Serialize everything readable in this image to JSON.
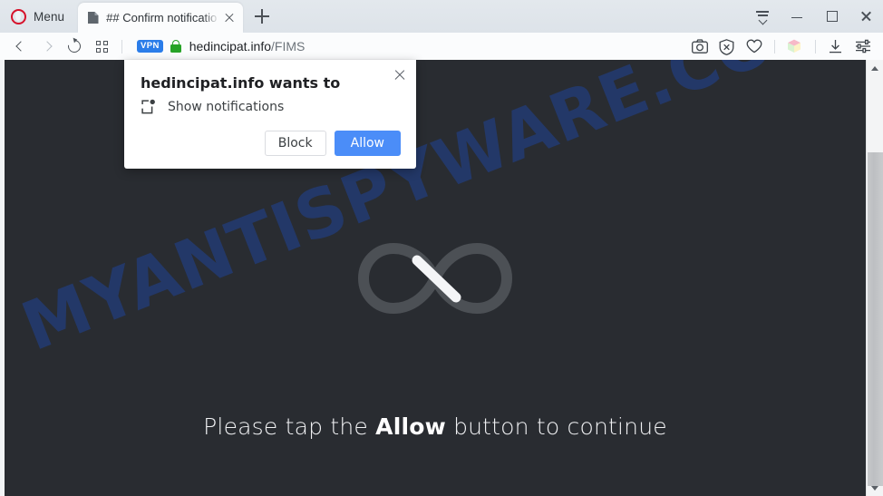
{
  "browser": {
    "name": "Opera",
    "menu_label": "Menu",
    "logo_icon": "opera-logo-icon",
    "tabs": [
      {
        "title": "## Confirm notificatio",
        "favicon": "page-document-icon",
        "close_icon": "close-icon",
        "active": true
      }
    ],
    "new_tab_icon": "plus-icon",
    "window_controls": [
      {
        "name": "tab-menu-button",
        "icon": "tab-list-chevron-icon"
      },
      {
        "name": "minimize-button",
        "icon": "minimize-icon"
      },
      {
        "name": "maximize-button",
        "icon": "maximize-icon"
      },
      {
        "name": "close-window-button",
        "icon": "close-icon"
      }
    ]
  },
  "navbar": {
    "back_icon": "chevron-left-icon",
    "forward_icon": "chevron-right-icon",
    "reload_icon": "reload-icon",
    "tiles_icon": "grid-tiles-icon",
    "vpn_badge": "VPN",
    "padlock_icon": "green-padlock-icon",
    "url": {
      "domain": "hedincipat.info",
      "path": "/FIMS",
      "full": "hedincipat.info/FIMS"
    },
    "tools": [
      {
        "name": "snapshot-button",
        "icon": "camera-icon"
      },
      {
        "name": "ad-blocker-button",
        "icon": "shield-block-icon"
      },
      {
        "name": "favorites-button",
        "icon": "heart-icon"
      },
      {
        "name": "my-flow-button",
        "icon": "cube-icon"
      },
      {
        "name": "downloads-button",
        "icon": "download-icon"
      },
      {
        "name": "easy-setup-button",
        "icon": "sliders-icon"
      }
    ]
  },
  "page": {
    "watermark": "MYANTISPYWARE.COM",
    "watermark_color": "#23396b",
    "background_color": "#292c31",
    "loader_icon": "infinity-spinner-icon",
    "loader_track_color": "#4c5055",
    "loader_segment_color": "#f4f5f7",
    "hint_prefix": "Please tap the ",
    "hint_emphasis": "Allow",
    "hint_suffix": " button to continue"
  },
  "scrollbar": {
    "up_arrow_icon": "scroll-up-arrow-icon",
    "down_arrow_icon": "scroll-down-arrow-icon",
    "thumb_name": "scrollbar-thumb"
  },
  "dialog": {
    "title": "hedincipat.info wants to",
    "permission_icon": "notification-badge-icon",
    "permission_label": "Show notifications",
    "close_icon": "close-icon",
    "block_label": "Block",
    "allow_label": "Allow",
    "allow_color": "#4b8df8"
  }
}
